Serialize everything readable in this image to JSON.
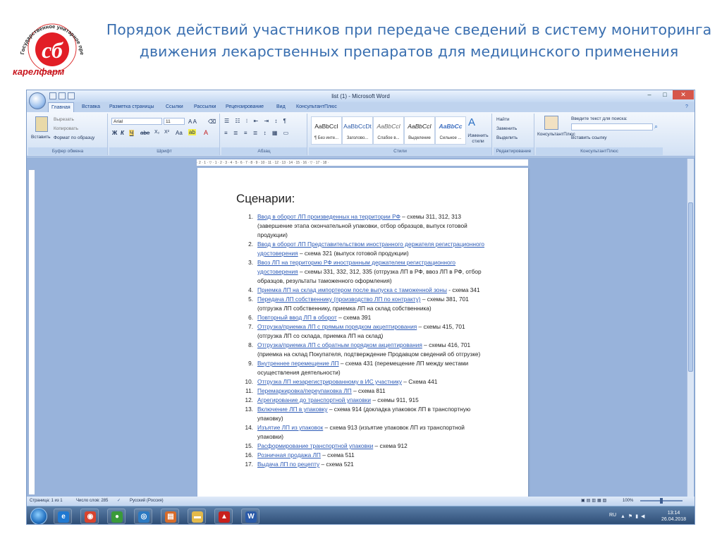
{
  "slide": {
    "title_line1": "Порядок действий участников при передаче сведений в систему мониторинга",
    "title_line2": "движения лекарственных препаратов для медицинского применения",
    "logo": {
      "ring_text": "Государственное унитарное предприятие РК",
      "brand_text": "карелфарм",
      "accent_color": "#e21e26"
    }
  },
  "window": {
    "title": "list (1) - Microsoft Word",
    "tabs": [
      "Главная",
      "Вставка",
      "Разметка страницы",
      "Ссылки",
      "Рассылки",
      "Рецензирование",
      "Вид",
      "КонсультантПлюс"
    ],
    "active_tab": "Главная",
    "ribbon": {
      "clipboard": {
        "paste": "Вставить",
        "cut": "Вырезать",
        "copy": "Копировать",
        "format_painter": "Формат по образцу",
        "label": "Буфер обмена"
      },
      "font": {
        "name": "Arial",
        "size": "11",
        "label": "Шрифт"
      },
      "paragraph": {
        "label": "Абзац"
      },
      "styles": {
        "items": [
          {
            "sample": "AaBbCcI",
            "name": "¶ Без инте..."
          },
          {
            "sample": "AaBbCcDt",
            "name": "Заголово..."
          },
          {
            "sample": "AaBbCcl",
            "name": "Слабое в..."
          },
          {
            "sample": "AaBbCcI",
            "name": "Выделение"
          },
          {
            "sample": "AaBbCc",
            "name": "Сильное ..."
          }
        ],
        "change_styles": "Изменить стили",
        "label": "Стили"
      },
      "editing": {
        "find": "Найти",
        "replace": "Заменить",
        "select": "Выделить",
        "label": "Редактирование"
      },
      "consultant": {
        "button": "КонсультантПлюс",
        "search_label": "Введите текст для поиска:",
        "insert_link": "Вставить ссылку",
        "label": "КонсультантПлюс"
      }
    }
  },
  "document": {
    "heading": "Сценарии:",
    "items": [
      {
        "num": "1.",
        "link": "Ввод в оборот ЛП произведенных на территории РФ",
        "rest": " – схемы 311, 312, 313 (завершение этапа окончательной упаковки, отбор образцов, выпуск готовой продукции)"
      },
      {
        "num": "2.",
        "link": "Ввод в оборот ЛП Представительством иностранного держателя регистрационного удостоверения",
        "rest": " – схема 321 (выпуск готовой продукции)"
      },
      {
        "num": "3.",
        "link": "Ввоз ЛП на территорию РФ иностранным держателем регистрационного удостоверения",
        "rest": " – схемы 331, 332, 312, 335 (отгрузка ЛП в РФ, ввоз ЛП в РФ, отбор образцов, результаты таможенного оформления)"
      },
      {
        "num": "4.",
        "link": "Приемка ЛП на склад импортером после выпуска с таможенной зоны",
        "rest": " - схема 341"
      },
      {
        "num": "5.",
        "link": "Передача ЛП собственнику (производство ЛП по контракту)",
        "rest": " – схемы 381, 701 (отгрузка ЛП собственнику, приемка ЛП на склад собственника)"
      },
      {
        "num": "6.",
        "link": "Повторный ввод ЛП в оборот",
        "rest": " – схема 391"
      },
      {
        "num": "7.",
        "link": "Отгрузка/приемка ЛП с прямым порядком акцептирования",
        "rest": " – схемы 415, 701 (отгрузка ЛП со склада, приемка ЛП на склад)"
      },
      {
        "num": "8.",
        "link": "Отгрузка/приемка ЛП с обратным порядком акцептирования",
        "rest": " – схемы 416, 701 (приемка на склад Покупателя, подтверждение Продавцом сведений об отгрузке)"
      },
      {
        "num": "9.",
        "link": "Внутреннее перемещение ЛП",
        "rest": " – схема 431 (перемещение ЛП между местами осуществления деятельности)"
      },
      {
        "num": "10.",
        "link": "Отгрузка ЛП незарегистрированному в ИС участнику",
        "rest": " – Схема 441"
      },
      {
        "num": "11.",
        "link": "Перемаркировка/переупаковка ЛП",
        "rest": " – схема 811"
      },
      {
        "num": "12.",
        "link": "Агрегирование до транспортной упаковки",
        "rest": " – схемы 911, 915"
      },
      {
        "num": "13.",
        "link": "Включение ЛП в упаковку",
        "rest": " – схема 914 (докладка упаковок ЛП в транспортную упаковку)"
      },
      {
        "num": "14.",
        "link": "Изъятие ЛП из упаковок",
        "rest": " – схема 913 (изъятие упаковок ЛП из транспортной упаковки)"
      },
      {
        "num": "15.",
        "link": "Расформирование транспортной упаковки",
        "rest": " – схема 912"
      },
      {
        "num": "16.",
        "link": "Розничная продажа ЛП",
        "rest": " – схема 511"
      },
      {
        "num": "17.",
        "link": "Выдача ЛП по рецепту",
        "rest": " – схема 521"
      }
    ]
  },
  "statusbar": {
    "page": "Страница: 1 из 1",
    "words": "Число слов: 285",
    "language": "Русский (Россия)",
    "zoom": "100%",
    "zoom_fraction": 0.5
  },
  "taskbar": {
    "language": "RU",
    "time": "13:14",
    "date": "26.04.2018",
    "apps": [
      {
        "name": "ie-icon",
        "glyph": "e",
        "color": "#1f78d1"
      },
      {
        "name": "chrome-icon",
        "glyph": "◉",
        "color": "#d8432e"
      },
      {
        "name": "user-icon",
        "glyph": "●",
        "color": "#3a9a3a"
      },
      {
        "name": "skype-icon",
        "glyph": "◎",
        "color": "#2b79c2"
      },
      {
        "name": "notes-icon",
        "glyph": "▤",
        "color": "#d76b2a"
      },
      {
        "name": "folder-icon",
        "glyph": "▬",
        "color": "#e3b94a"
      },
      {
        "name": "pdf-icon",
        "glyph": "▲",
        "color": "#c8201c"
      },
      {
        "name": "word-icon",
        "glyph": "W",
        "color": "#2a5aa8"
      }
    ]
  }
}
